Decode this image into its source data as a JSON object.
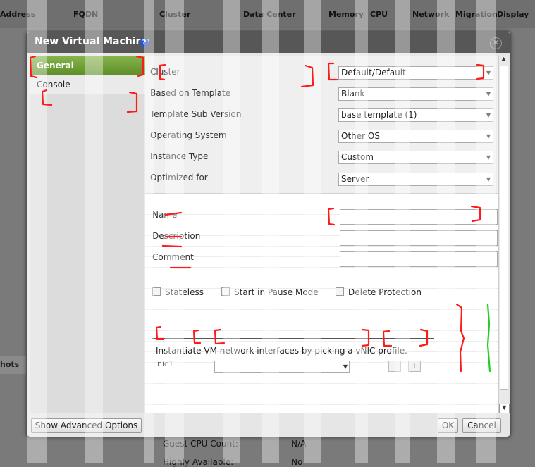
{
  "background": {
    "columns": [
      "Address",
      "FQDN",
      "Cluster",
      "Data Center",
      "Memory",
      "CPU",
      "Network",
      "Migration",
      "Display"
    ],
    "snapshots_tab": "hots",
    "info_rows": [
      {
        "label": "Guest CPU Count:",
        "value": "N/A"
      },
      {
        "label": "Highly Available:",
        "value": "No"
      }
    ]
  },
  "dialog": {
    "title": "New Virtual Machine",
    "help_icon": "?",
    "close_icon": "×"
  },
  "nav": {
    "general": "General",
    "console": "Console"
  },
  "fields": {
    "cluster": {
      "label": "Cluster",
      "value": "Default/Default"
    },
    "template": {
      "label": "Based on Template",
      "value": "Blank"
    },
    "subversion": {
      "label": "Template Sub Version",
      "value": "base template (1)"
    },
    "os": {
      "label": "Operating System",
      "value": "Other OS"
    },
    "instance_type": {
      "label": "Instance Type",
      "value": "Custom"
    },
    "optimized": {
      "label": "Optimized for",
      "value": "Server"
    },
    "name": {
      "label": "Name",
      "value": ""
    },
    "description": {
      "label": "Description",
      "value": ""
    },
    "comment": {
      "label": "Comment",
      "value": ""
    }
  },
  "checkboxes": {
    "stateless": "Stateless",
    "pause": "Start in Pause Mode",
    "protection": "Delete Protection"
  },
  "network": {
    "instruction": "Instantiate VM network interfaces by picking a vNIC profile.",
    "nic_label": "nic1",
    "minus": "−",
    "plus": "+"
  },
  "buttons": {
    "advanced": "Show Advanced Options",
    "ok": "OK",
    "cancel": "Cancel"
  },
  "icons": [
    "help-icon",
    "close-icon",
    "dropdown-arrow-icon",
    "scroll-up-icon",
    "scroll-down-icon"
  ],
  "colors": {
    "nav_active": "#6f9d35",
    "titlebar": "#575757",
    "annotation_red": "#ff0000",
    "annotation_green": "#00cc00"
  }
}
